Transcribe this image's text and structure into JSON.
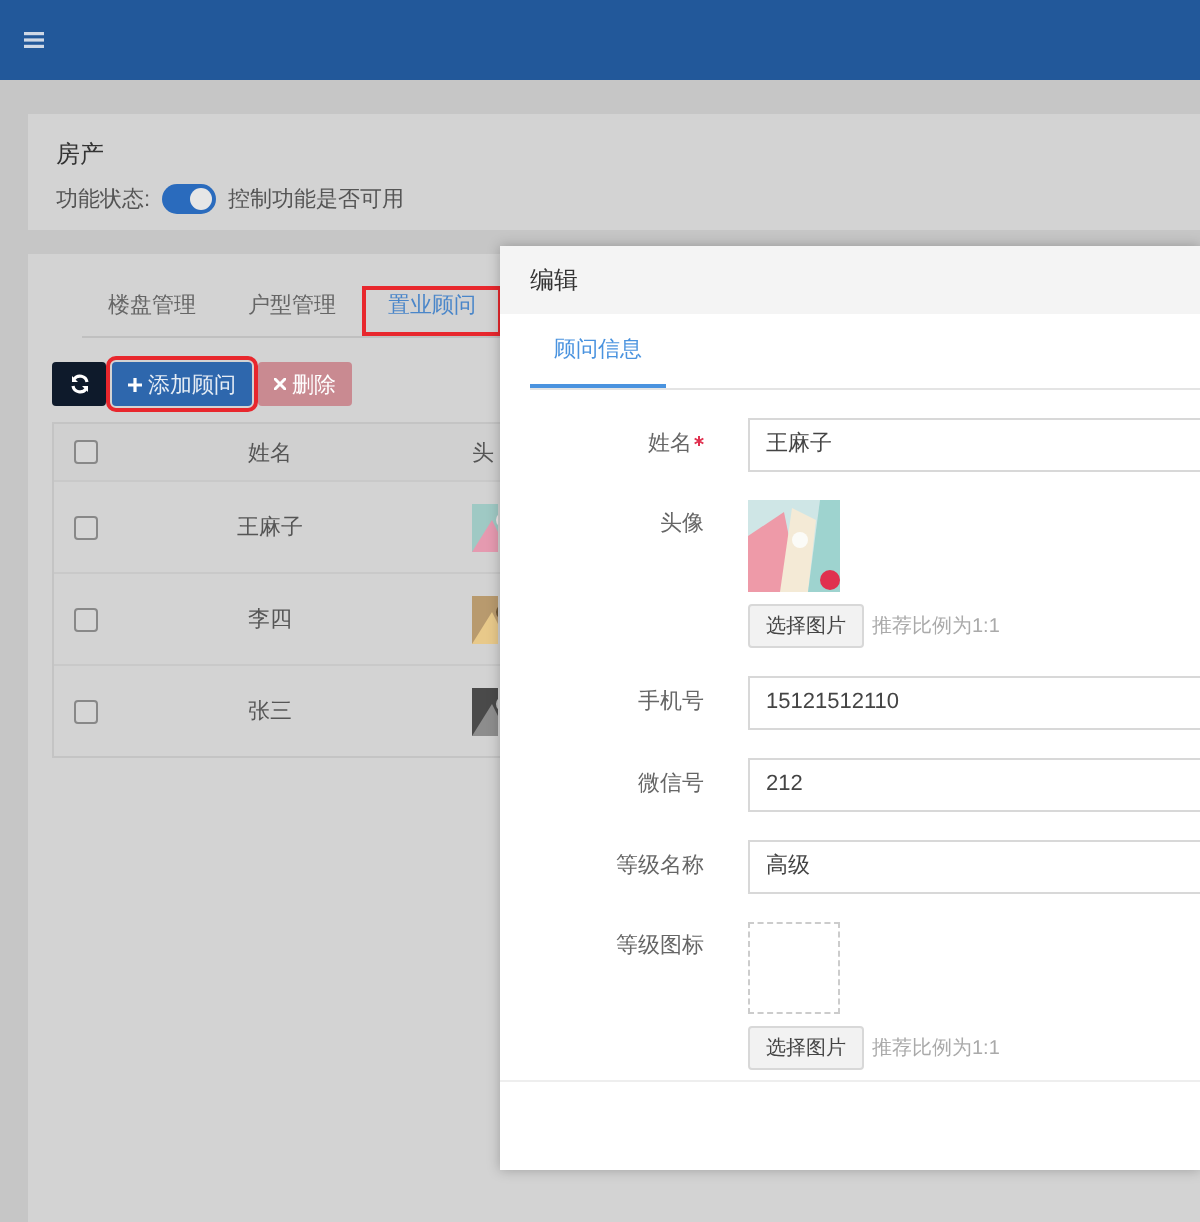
{
  "module": {
    "title": "房产",
    "status_label": "功能状态:",
    "status_on": true,
    "status_hint": "控制功能是否可用"
  },
  "tabs": [
    {
      "label": "楼盘管理",
      "selected": false,
      "highlighted": false
    },
    {
      "label": "户型管理",
      "selected": false,
      "highlighted": false
    },
    {
      "label": "置业顾问",
      "selected": true,
      "highlighted": true
    }
  ],
  "toolbar": [
    {
      "kind": "refresh",
      "highlighted": false,
      "disabled": false
    },
    {
      "kind": "add",
      "label": "添加顾问",
      "highlighted": true,
      "disabled": false
    },
    {
      "kind": "delete",
      "label": "删除",
      "highlighted": false,
      "disabled": true
    }
  ],
  "table": {
    "header_checked": false,
    "columns": [
      "姓名",
      "头"
    ],
    "rows": [
      {
        "name": "王麻子",
        "checked": false
      },
      {
        "name": "李四",
        "checked": false
      },
      {
        "name": "张三",
        "checked": false
      }
    ]
  },
  "dialog": {
    "title": "编辑",
    "tabs": [
      {
        "label": "顾问信息",
        "selected": true
      }
    ],
    "fields": [
      {
        "kind": "text",
        "label": "姓名",
        "required": true,
        "value": "王麻子"
      },
      {
        "label": "头像",
        "has_image": true,
        "button": "选择图片",
        "hint": "推荐比例为1:1"
      },
      {
        "kind": "text",
        "label": "手机号",
        "value": "15121512110"
      },
      {
        "kind": "text",
        "label": "微信号",
        "value": "212"
      },
      {
        "kind": "text",
        "label": "等级名称",
        "value": "高级"
      },
      {
        "label": "等级图标",
        "has_image": false,
        "button": "选择图片",
        "hint": "推荐比例为1:1"
      }
    ]
  }
}
